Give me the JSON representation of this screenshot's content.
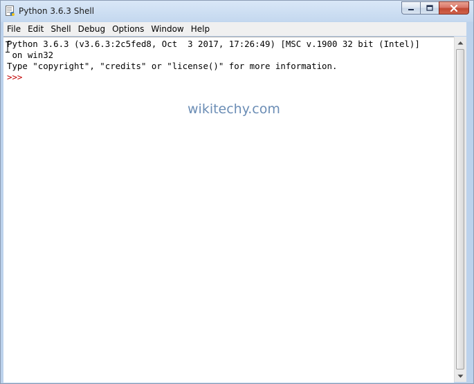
{
  "window": {
    "title": "Python 3.6.3 Shell",
    "icon": "python-idle-icon"
  },
  "caption_buttons": {
    "minimize": "minimize-icon",
    "maximize": "maximize-icon",
    "close": "close-icon"
  },
  "menubar": {
    "items": [
      {
        "label": "File"
      },
      {
        "label": "Edit"
      },
      {
        "label": "Shell"
      },
      {
        "label": "Debug"
      },
      {
        "label": "Options"
      },
      {
        "label": "Window"
      },
      {
        "label": "Help"
      }
    ]
  },
  "shell": {
    "lines": [
      "Python 3.6.3 (v3.6.3:2c5fed8, Oct  3 2017, 17:26:49) [MSC v.1900 32 bit (Intel)]",
      " on win32",
      "Type \"copyright\", \"credits\" or \"license()\" for more information."
    ],
    "prompt": ">>>"
  },
  "watermark": "wikitechy.com",
  "colors": {
    "prompt": "#c00000",
    "watermark": "#6b8db5",
    "close_button": "#c24933"
  }
}
